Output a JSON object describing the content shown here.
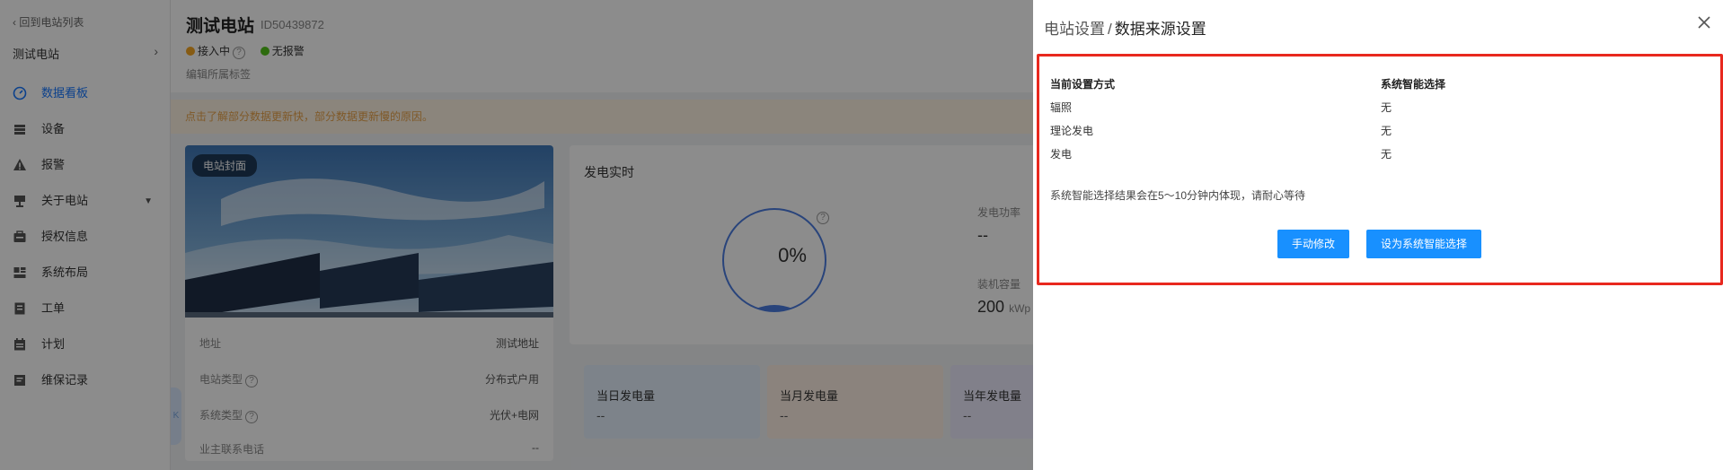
{
  "sidebar": {
    "back_label": "回到电站列表",
    "station_name": "测试电站",
    "items": [
      {
        "label": "数据看板",
        "icon": "dashboard-icon",
        "active": true
      },
      {
        "label": "设备",
        "icon": "device-icon",
        "active": false
      },
      {
        "label": "报警",
        "icon": "alarm-icon",
        "active": false
      },
      {
        "label": "关于电站",
        "icon": "station-icon",
        "active": false
      },
      {
        "label": "授权信息",
        "icon": "authorization-icon",
        "active": false
      },
      {
        "label": "系统布局",
        "icon": "layout-icon",
        "active": false
      },
      {
        "label": "工单",
        "icon": "work-order-icon",
        "active": false
      },
      {
        "label": "计划",
        "icon": "plan-icon",
        "active": false
      },
      {
        "label": "维保记录",
        "icon": "maintenance-icon",
        "active": false
      }
    ],
    "collapse_label": "K"
  },
  "header": {
    "title": "测试电站",
    "station_id": "ID50439872",
    "status_connect": "接入中",
    "status_alarm": "无报警",
    "edit_tag": "编辑所属标签"
  },
  "notice": "点击了解部分数据更新快，部分数据更新慢的原因。",
  "cover": {
    "label": "电站封面",
    "rows": [
      {
        "label": "地址",
        "value": "测试地址"
      },
      {
        "label": "电站类型",
        "value": "分布式户用"
      },
      {
        "label": "系统类型",
        "value": "光伏+电网"
      },
      {
        "label": "业主联系电话",
        "value": "--"
      }
    ]
  },
  "realtime": {
    "title": "发电实时",
    "percent_text": "0%",
    "power_label": "发电功率",
    "power_value": "--",
    "capacity_label": "装机容量",
    "capacity_value": "200",
    "capacity_unit": "kWp"
  },
  "energy": {
    "day_label": "当日发电量",
    "day_value": "--",
    "month_label": "当月发电量",
    "month_value": "--",
    "year_label": "当年发电量",
    "year_value": "--"
  },
  "drawer": {
    "breadcrumb_parent": "电站设置",
    "breadcrumb_sep": "/",
    "breadcrumb_current": "数据来源设置",
    "col_current": "当前设置方式",
    "col_smart": "系统智能选择",
    "rows": [
      {
        "name": "辐照",
        "smart": "无"
      },
      {
        "name": "理论发电",
        "smart": "无"
      },
      {
        "name": "发电",
        "smart": "无"
      }
    ],
    "note": "系统智能选择结果会在5～10分钟内体现，请耐心等待",
    "btn_manual": "手动修改",
    "btn_smart": "设为系统智能选择"
  },
  "colors": {
    "primary": "#1890ff",
    "highlight": "#e8281e",
    "status_connecting": "#f5a623",
    "status_ok": "#52c41a"
  }
}
